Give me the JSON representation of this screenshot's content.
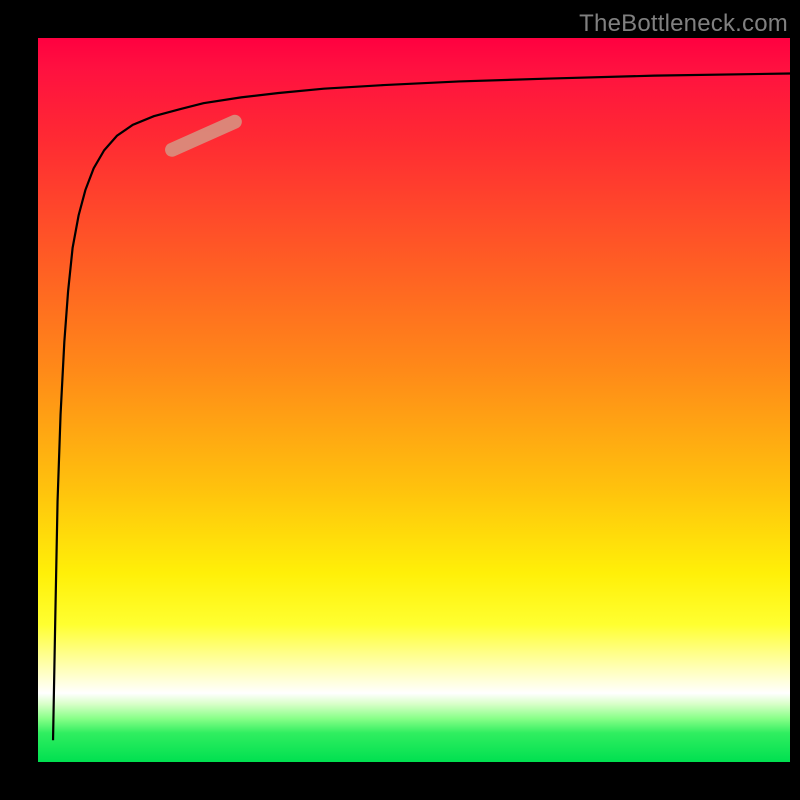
{
  "watermark": "TheBottleneck.com",
  "chart_data": {
    "type": "line",
    "title": "",
    "xlabel": "",
    "ylabel": "",
    "xlim": [
      0,
      100
    ],
    "ylim": [
      0,
      100
    ],
    "grid": false,
    "legend": false,
    "background_gradient": [
      {
        "stop": 0,
        "color": "#ff0040"
      },
      {
        "stop": 30,
        "color": "#ff5a25"
      },
      {
        "stop": 62,
        "color": "#ffc10d"
      },
      {
        "stop": 86,
        "color": "#ffffa0"
      },
      {
        "stop": 90,
        "color": "#ffffff"
      },
      {
        "stop": 100,
        "color": "#00e050"
      }
    ],
    "series": [
      {
        "name": "curve",
        "x": [
          2.0,
          2.3,
          2.6,
          3.0,
          3.5,
          4.0,
          4.6,
          5.4,
          6.3,
          7.4,
          8.8,
          10.5,
          12.6,
          15.4,
          19.0,
          22.0,
          27.0,
          32.0,
          38.0,
          46.0,
          56.0,
          68.0,
          82.0,
          100.0
        ],
        "y": [
          3.0,
          20.0,
          36.0,
          48.0,
          58.0,
          65.0,
          71.0,
          75.5,
          79.0,
          82.0,
          84.5,
          86.5,
          88.0,
          89.2,
          90.2,
          91.0,
          91.8,
          92.4,
          93.0,
          93.5,
          94.0,
          94.4,
          94.8,
          95.1
        ]
      }
    ],
    "highlight_segment": {
      "x_center": 22.0,
      "y_center": 86.5,
      "angle_deg": 24,
      "length_pct": 11,
      "color": "#d89080",
      "opacity": 0.9
    }
  }
}
